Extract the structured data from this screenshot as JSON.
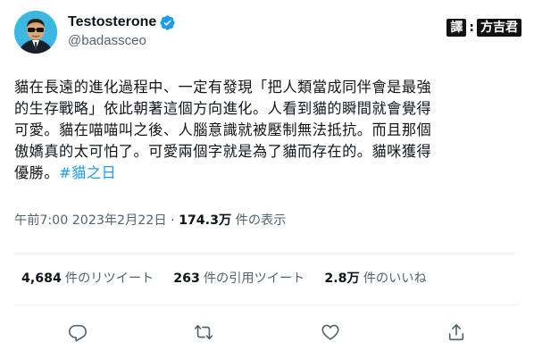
{
  "tweet": {
    "display_name": "Testosterone",
    "handle": "@badassceo",
    "translator_label": "譯",
    "translator_separator": ":",
    "translator_name": "方吉君",
    "text_lines": [
      "貓在長遠的進化過程中、一定有發現「把人類當成同伴會是最強",
      "的生存戰略」依此朝著這個方向進化。人看到貓的瞬間就會覺得",
      "可愛。貓在喵喵叫之後、人腦意識就被壓制無法抵抗。而且那個",
      "傲嬌真的太可怕了。可愛兩個字就是為了貓而存在的。貓咪獲得",
      "優勝。"
    ],
    "hashtag": "#貓之日",
    "time": "午前7:00",
    "date": "2023年2月22日",
    "separator": "·",
    "views_count": "174.3万",
    "views_label": "件の表示"
  },
  "stats": {
    "retweets_count": "4,684",
    "retweets_label": "件のリツイート",
    "quotes_count": "263",
    "quotes_label": "件の引用ツイート",
    "likes_count": "2.8万",
    "likes_label": "件のいいね"
  },
  "icons": {
    "verified": "verified-badge-icon",
    "reply": "reply-icon",
    "retweet": "retweet-icon",
    "like": "heart-icon",
    "share": "share-icon"
  },
  "colors": {
    "accent": "#1d9bf0",
    "text": "#0f1419",
    "muted": "#536471",
    "divider": "#eff3f4"
  }
}
